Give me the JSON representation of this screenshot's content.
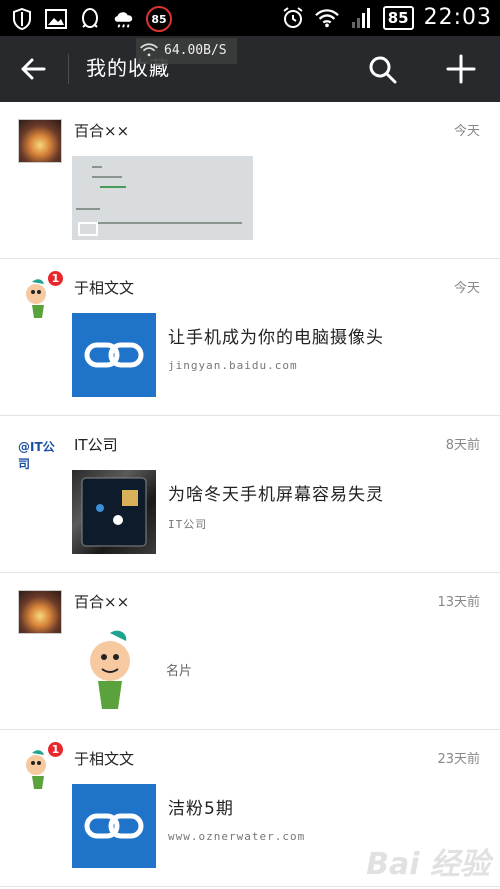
{
  "status_bar": {
    "notification_badge": "85",
    "battery": "85",
    "time": "22:03"
  },
  "toolbar": {
    "title": "我的收藏",
    "speed": "64.00B/S"
  },
  "items": [
    {
      "name": "百合××",
      "time": "今天",
      "type": "image"
    },
    {
      "name": "于相文文",
      "time": "今天",
      "type": "link",
      "unread": "1",
      "title": "让手机成为你的电脑摄像头",
      "subtitle": "jingyan.baidu.com"
    },
    {
      "name": "IT公司",
      "time": "8天前",
      "type": "article",
      "avatar_text": "@IT公司",
      "title": "为啥冬天手机屏幕容易失灵",
      "subtitle": "IT公司"
    },
    {
      "name": "百合××",
      "time": "13天前",
      "type": "card",
      "label": "名片"
    },
    {
      "name": "于相文文",
      "time": "23天前",
      "type": "link",
      "unread": "1",
      "title": "洁粉5期",
      "subtitle": "www.oznerwater.com"
    }
  ],
  "watermark": "Bai 经验"
}
